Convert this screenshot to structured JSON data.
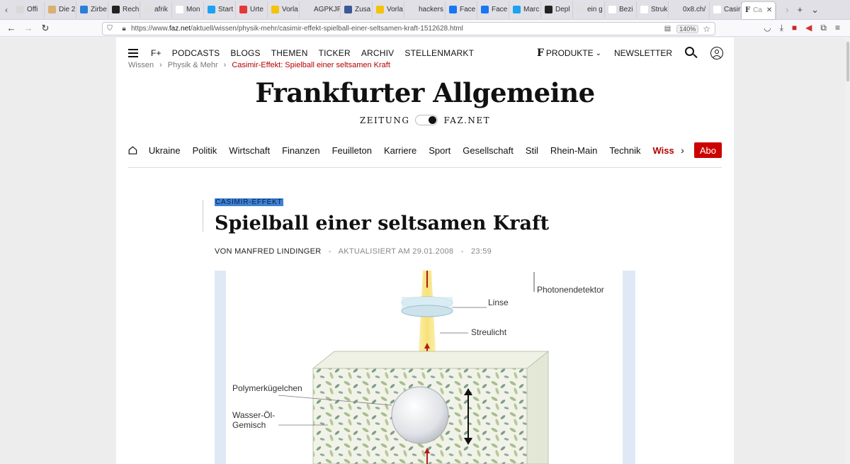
{
  "browser": {
    "tabs": [
      {
        "label": "Offi",
        "color": "#d9d9d9"
      },
      {
        "label": "Die 2",
        "color": "#d8b070"
      },
      {
        "label": "Zirbe",
        "color": "#2a7fd6"
      },
      {
        "label": "Rech",
        "color": "#222"
      },
      {
        "label": "afrik",
        "color": "#e0e0e0"
      },
      {
        "label": "Mon",
        "color": "#fff"
      },
      {
        "label": "Start",
        "color": "#1da1f2"
      },
      {
        "label": "Urte",
        "color": "#e53935"
      },
      {
        "label": "Vorla",
        "color": "#f4c20d"
      },
      {
        "label": "AGPKJP",
        "color": "#e0e0e6"
      },
      {
        "label": "Zusa",
        "color": "#3b5998"
      },
      {
        "label": "Vorla",
        "color": "#f4c20d"
      },
      {
        "label": "hackers",
        "color": "#e0e0e6"
      },
      {
        "label": "Face",
        "color": "#1877f2"
      },
      {
        "label": "Face",
        "color": "#1877f2"
      },
      {
        "label": "Marc",
        "color": "#1da1f2"
      },
      {
        "label": "Depl",
        "color": "#222"
      },
      {
        "label": "ein g",
        "color": "#e0e0e0"
      },
      {
        "label": "Bezi",
        "color": "#fff"
      },
      {
        "label": "Struk",
        "color": "#fff"
      },
      {
        "label": "0x8.ch/",
        "color": "#e0e0e6"
      },
      {
        "label": "Casir",
        "color": "#fff"
      }
    ],
    "active_tab_label": "Ca",
    "url_prefix": "https://www.",
    "url_domain": "faz.net",
    "url_path": "/aktuell/wissen/physik-mehr/casimir-effekt-spielball-einer-seltsamen-kraft-1512628.html",
    "zoom": "140%"
  },
  "topnav": {
    "items": [
      "F+",
      "PODCASTS",
      "BLOGS",
      "THEMEN",
      "TICKER",
      "ARCHIV",
      "STELLENMARKT"
    ],
    "produkte": "PRODUKTE",
    "newsletter": "NEWSLETTER"
  },
  "breadcrumb": {
    "items": [
      "Wissen",
      "Physik & Mehr"
    ],
    "current": "Casimir-Effekt: Spielball einer seltsamen Kraft"
  },
  "logo": {
    "title": "Frankfurter Allgemeine",
    "left": "ZEITUNG",
    "right": "FAZ.NET"
  },
  "sections": {
    "items": [
      "Ukraine",
      "Politik",
      "Wirtschaft",
      "Finanzen",
      "Feuilleton",
      "Karriere",
      "Sport",
      "Gesellschaft",
      "Stil",
      "Rhein-Main",
      "Technik"
    ],
    "active": "Wissen",
    "abo": "Abo"
  },
  "article": {
    "kicker": "CASIMIR-EFFEKT",
    "headline": "Spielball einer seltsamen Kraft",
    "author": "VON MANFRED LINDINGER",
    "updated": "AKTUALISIERT AM 29.01.2008",
    "time": "23:59"
  },
  "figure": {
    "labels": {
      "detector": "Photonendetektor",
      "lens": "Linse",
      "scatter": "Streulicht",
      "polymer": "Polymerkügelchen",
      "mixture_1": "Wasser-Öl-",
      "mixture_2": "Gemisch"
    }
  }
}
